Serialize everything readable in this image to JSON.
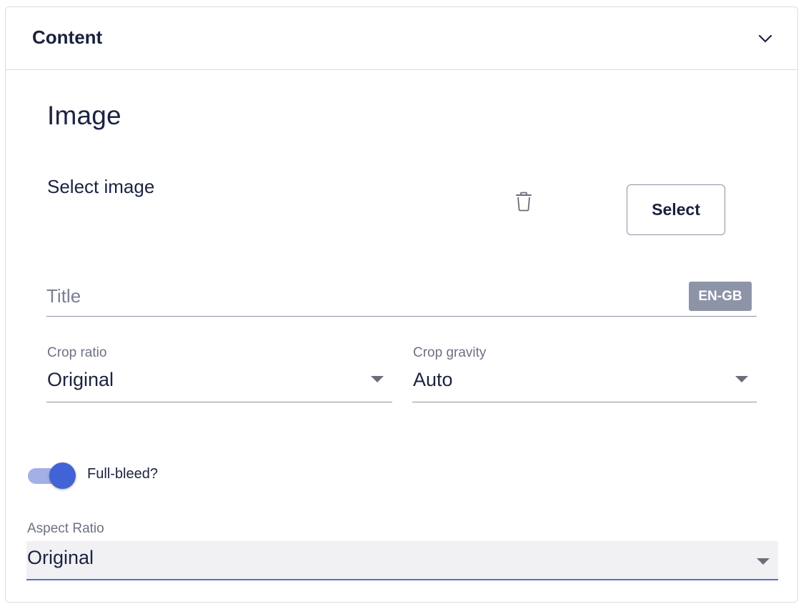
{
  "panel": {
    "title": "Content",
    "chevron_icon": "chevron-down-icon"
  },
  "section": {
    "title": "Image"
  },
  "image_picker": {
    "label": "Select image",
    "delete_icon": "trash-icon",
    "select_button": "Select"
  },
  "title_field": {
    "placeholder": "Title",
    "value": "",
    "locale": "EN-GB"
  },
  "crop_ratio": {
    "label": "Crop ratio",
    "value": "Original"
  },
  "crop_gravity": {
    "label": "Crop gravity",
    "value": "Auto"
  },
  "full_bleed": {
    "label": "Full-bleed?",
    "checked": true,
    "accent": "#4263d6"
  },
  "aspect_ratio": {
    "label": "Aspect Ratio",
    "value": "Original"
  }
}
